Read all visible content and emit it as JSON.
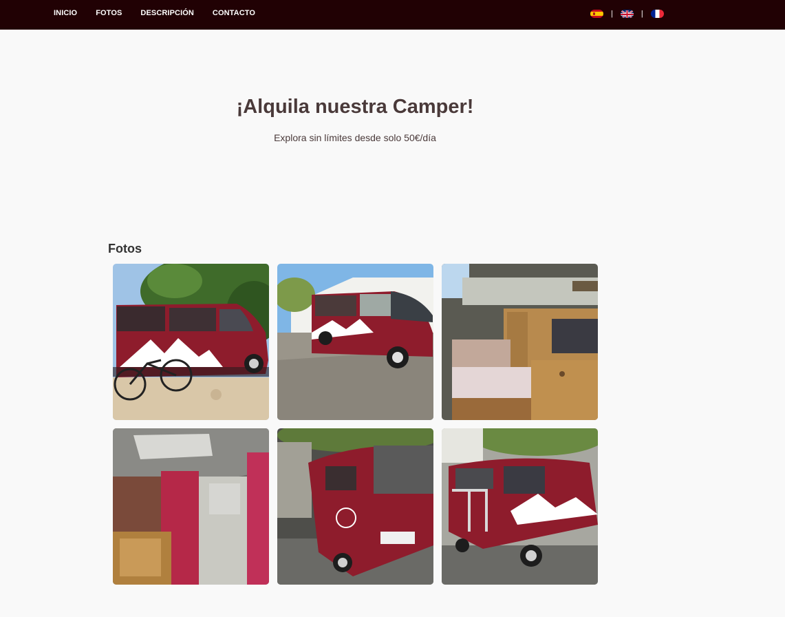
{
  "nav": {
    "links": [
      "INICIO",
      "FOTOS",
      "DESCRIPCIÓN",
      "CONTACTO"
    ],
    "separator": "|",
    "languages": [
      {
        "icon": "spain-flag-icon"
      },
      {
        "icon": "uk-flag-icon"
      },
      {
        "icon": "france-flag-icon"
      }
    ]
  },
  "hero": {
    "title": "¡Alquila nuestra Camper!",
    "subtitle": "Explora sin límites desde solo 50€/día"
  },
  "gallery": {
    "title": "Fotos",
    "photos": [
      {
        "name": "photo-van-side-with-bike"
      },
      {
        "name": "photo-van-front-street"
      },
      {
        "name": "photo-van-interior-bed"
      },
      {
        "name": "photo-van-interior-curtains"
      },
      {
        "name": "photo-van-rear-left"
      },
      {
        "name": "photo-van-rear-bike-rack"
      }
    ]
  },
  "colors": {
    "navbar_bg": "#210104",
    "van_red": "#8e1c2c",
    "text": "#4a3a3a",
    "page_bg": "#f9f9f9"
  }
}
